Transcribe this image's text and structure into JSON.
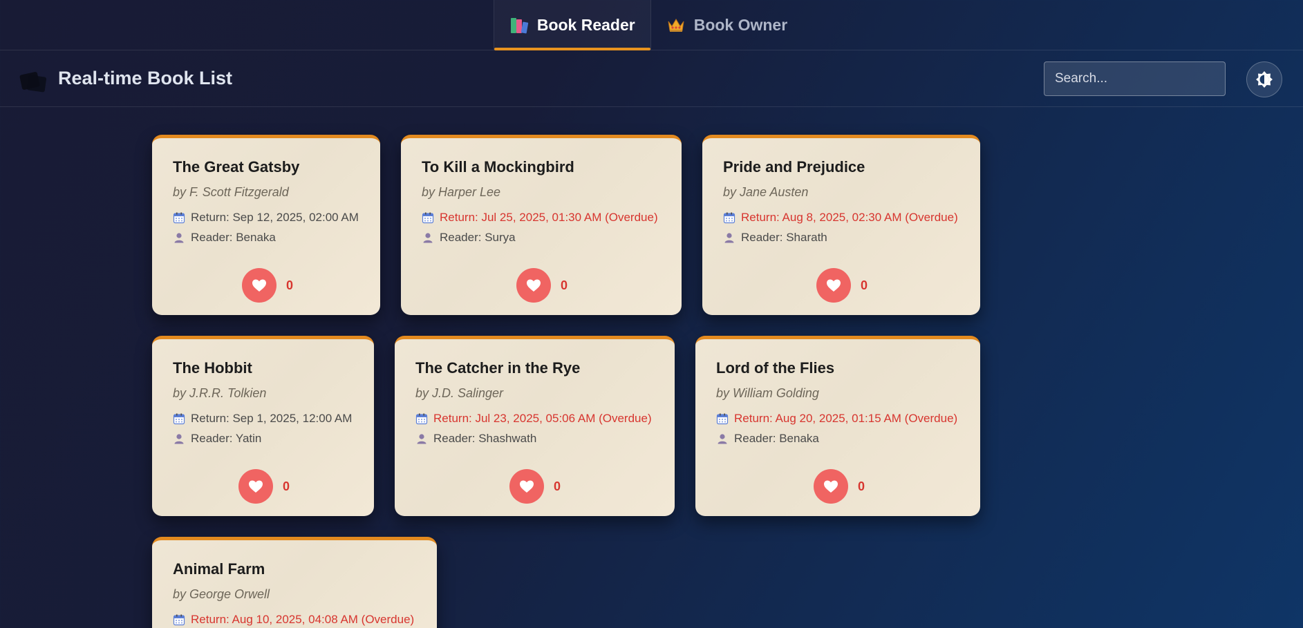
{
  "tabs": [
    {
      "label": "Book Reader",
      "icon": "books-icon",
      "active": true
    },
    {
      "label": "Book Owner",
      "icon": "crown-icon",
      "active": false
    }
  ],
  "header": {
    "title": "Real-time Book List",
    "logo_icon": "books-icon",
    "search": {
      "placeholder": "Search...",
      "value": ""
    },
    "theme_toggle_icon": "brightness-icon"
  },
  "colors": {
    "accent": "#e8931f",
    "overdue": "#d7352f",
    "like": "#f06462",
    "card_bg": "#efe6d5"
  },
  "books": [
    {
      "title": "The Great Gatsby",
      "author": "by F. Scott Fitzgerald",
      "return_label": "Return: Sep 12, 2025, 02:00 AM",
      "overdue": false,
      "reader": "Reader: Benaka",
      "likes": "0"
    },
    {
      "title": "To Kill a Mockingbird",
      "author": "by Harper Lee",
      "return_label": "Return: Jul 25, 2025, 01:30 AM (Overdue)",
      "overdue": true,
      "reader": "Reader: Surya",
      "likes": "0"
    },
    {
      "title": "Pride and Prejudice",
      "author": "by Jane Austen",
      "return_label": "Return: Aug 8, 2025, 02:30 AM (Overdue)",
      "overdue": true,
      "reader": "Reader: Sharath",
      "likes": "0"
    },
    {
      "title": "The Hobbit",
      "author": "by J.R.R. Tolkien",
      "return_label": "Return: Sep 1, 2025, 12:00 AM",
      "overdue": false,
      "reader": "Reader: Yatin",
      "likes": "0"
    },
    {
      "title": "The Catcher in the Rye",
      "author": "by J.D. Salinger",
      "return_label": "Return: Jul 23, 2025, 05:06 AM (Overdue)",
      "overdue": true,
      "reader": "Reader: Shashwath",
      "likes": "0"
    },
    {
      "title": "Lord of the Flies",
      "author": "by William Golding",
      "return_label": "Return: Aug 20, 2025, 01:15 AM (Overdue)",
      "overdue": true,
      "reader": "Reader: Benaka",
      "likes": "0"
    },
    {
      "title": "Animal Farm",
      "author": "by George Orwell",
      "return_label": "Return: Aug 10, 2025, 04:08 AM (Overdue)",
      "overdue": true,
      "reader": "",
      "likes": ""
    }
  ]
}
